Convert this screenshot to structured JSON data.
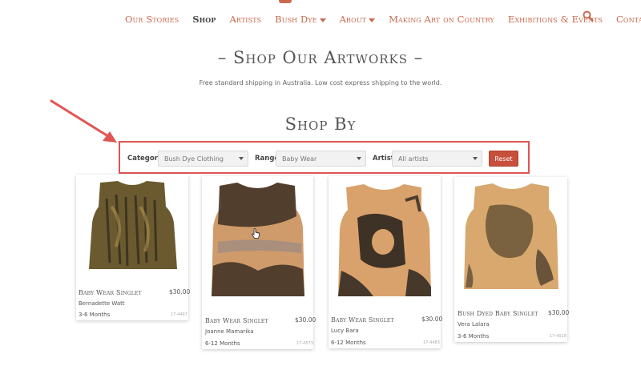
{
  "nav": {
    "items": [
      {
        "label": "Our Stories",
        "active": false,
        "dropdown": false
      },
      {
        "label": "Shop",
        "active": true,
        "dropdown": false
      },
      {
        "label": "Artists",
        "active": false,
        "dropdown": false
      },
      {
        "label": "Bush Dye",
        "active": false,
        "dropdown": true
      },
      {
        "label": "About",
        "active": false,
        "dropdown": true
      },
      {
        "label": "Making Art on Country",
        "active": false,
        "dropdown": false
      },
      {
        "label": "Exhibitions & Events",
        "active": false,
        "dropdown": false
      },
      {
        "label": "Contact",
        "active": false,
        "dropdown": false
      }
    ],
    "search_icon": "search-icon"
  },
  "page": {
    "title": "– Shop Our Artworks –",
    "shipping_note": "Free standard shipping in Australia. Low cost express shipping to the world.",
    "shop_by_title": "Shop By"
  },
  "filters": {
    "category_label": "Category",
    "category_value": "Bush Dye Clothing",
    "range_label": "Range",
    "range_value": "Baby Wear",
    "artist_label": "Artist",
    "artist_value": "All artists",
    "reset_label": "Reset"
  },
  "products": [
    {
      "name": "Baby Wear Singlet",
      "price": "$30.00",
      "artist": "Bernadette Watt",
      "size": "3-6 Months",
      "code": "17-4497"
    },
    {
      "name": "Baby Wear Singlet",
      "price": "$30.00",
      "artist": "Joanne Mamarika",
      "size": "6-12 Months",
      "code": "17-4573"
    },
    {
      "name": "Baby Wear Singlet",
      "price": "$30.00",
      "artist": "Lucy Bara",
      "size": "6-12 Months",
      "code": "17-4483"
    },
    {
      "name": "Bush Dyed Baby Singlet",
      "price": "$30.00",
      "artist": "Vera Lalara",
      "size": "3-6 Months",
      "code": "17-4018"
    }
  ],
  "colors": {
    "accent": "#c86a4e",
    "reset_button": "#c74f3b",
    "annotation": "#e05555"
  }
}
